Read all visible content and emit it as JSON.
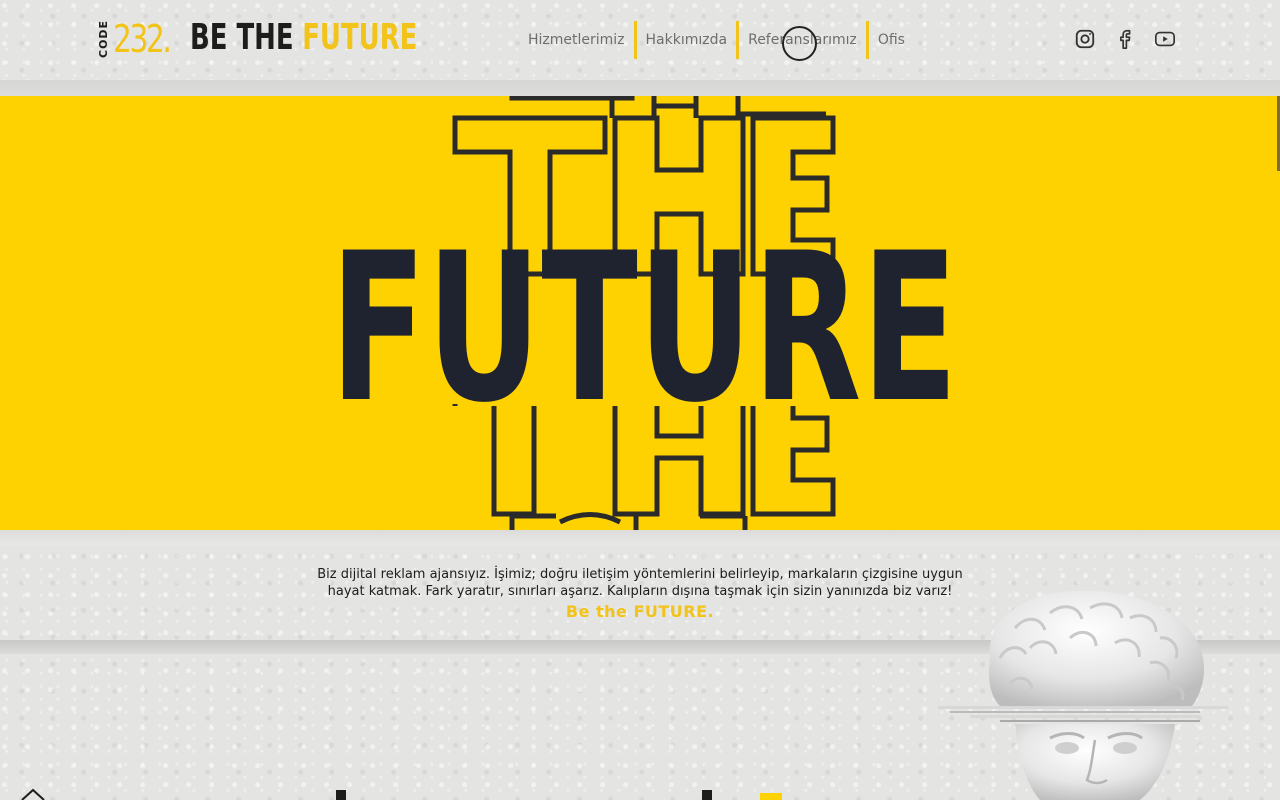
{
  "header": {
    "logo": {
      "prefix": "CODE",
      "number": "232."
    },
    "tagline": {
      "part1": "BE THE",
      "part2": "FUTURE"
    },
    "nav": [
      {
        "label": "Hizmetlerimiz"
      },
      {
        "label": "Hakkımızda"
      },
      {
        "label": "Referanslarımız"
      },
      {
        "label": "Ofis"
      }
    ],
    "social": [
      {
        "icon": "instagram-icon"
      },
      {
        "icon": "facebook-icon"
      },
      {
        "icon": "youtube-icon"
      }
    ]
  },
  "hero": {
    "headline": "FUTURE",
    "outline_word": "THE",
    "background": "#fed100",
    "text_color": "#1f2330"
  },
  "intro": {
    "line1": "Biz dijital reklam ajansıyız. İşimiz; doğru iletişim yöntemlerini belirleyip, markaların çizgisine uygun",
    "line2": "hayat katmak. Fark yaratır, sınırları aşarız. Kalıpların dışına taşmak için sizin yanınızda biz varız!",
    "cta": "Be the FUTURE."
  },
  "colors": {
    "accent": "#f2c318",
    "dark": "#1d1d1b",
    "page_bg": "#e4e4e2"
  }
}
